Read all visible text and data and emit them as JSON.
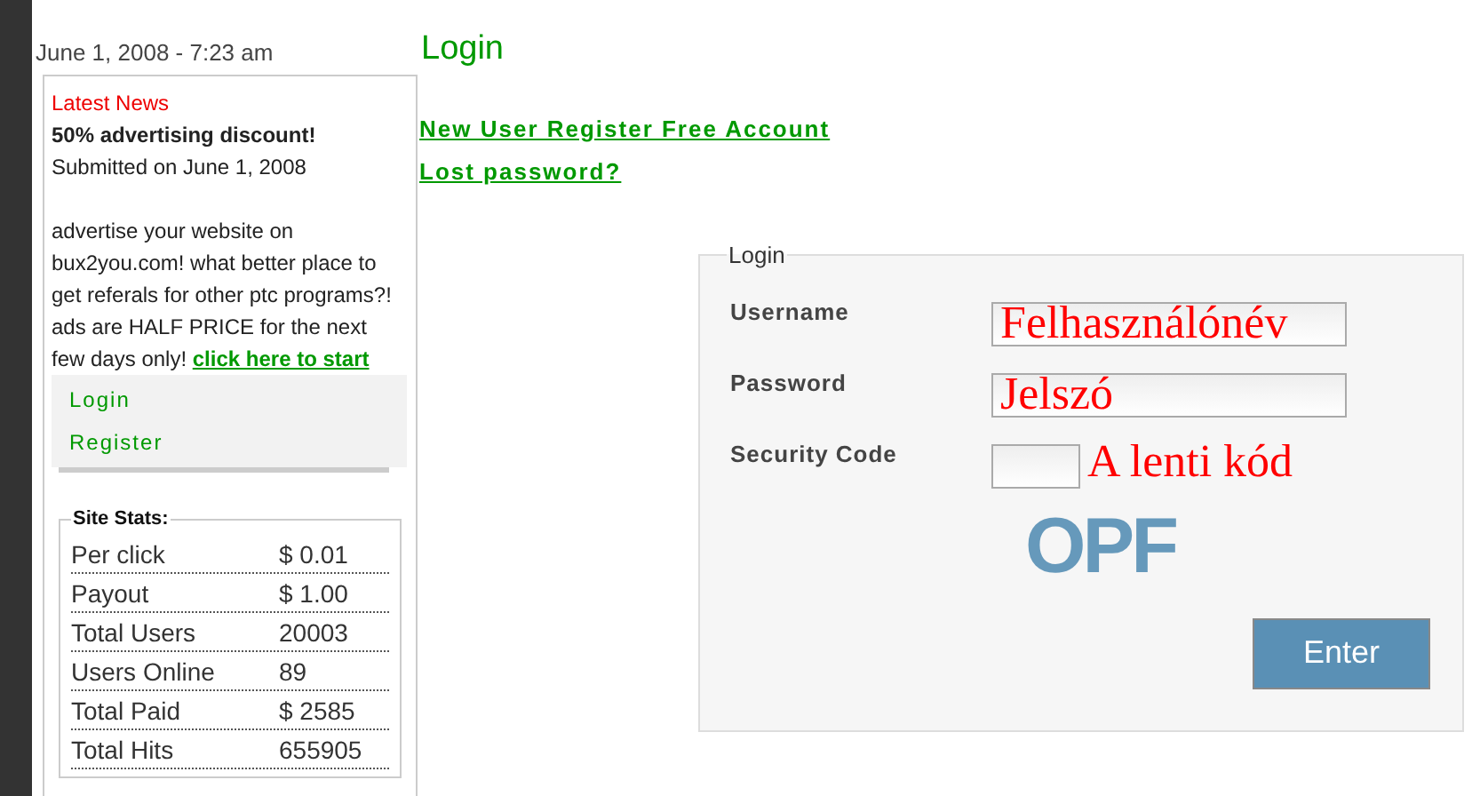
{
  "date": "June 1, 2008 - 7:23 am",
  "news": {
    "heading": "Latest News",
    "title": "50% advertising discount!",
    "submitted": "Submitted on June 1, 2008",
    "body": "advertise your website on bux2you.com! what better place to get referals for other ptc programs?! ads are HALF PRICE for the next few days only!",
    "link": "click here to start"
  },
  "menu": [
    {
      "label": "Login"
    },
    {
      "label": "Register"
    }
  ],
  "stats": {
    "title": "Site Stats:",
    "rows": [
      {
        "label": "Per click",
        "value": "$ 0.01"
      },
      {
        "label": "Payout",
        "value": "$ 1.00"
      },
      {
        "label": "Total Users",
        "value": "20003"
      },
      {
        "label": "Users Online",
        "value": "89"
      },
      {
        "label": "Total Paid",
        "value": "$ 2585"
      },
      {
        "label": "Total Hits",
        "value": "655905"
      }
    ]
  },
  "page_title": "Login",
  "links": [
    "New User Register Free Account",
    "Lost password?"
  ],
  "form": {
    "legend": "Login",
    "fields": [
      {
        "label": "Username",
        "annotation": "Felhasználónév",
        "kind": "text"
      },
      {
        "label": "Password",
        "annotation": "Jelszó",
        "kind": "text"
      },
      {
        "label": "Security Code",
        "annotation": "A lenti kód",
        "kind": "code"
      }
    ],
    "captcha": "OPF",
    "button": "Enter"
  }
}
